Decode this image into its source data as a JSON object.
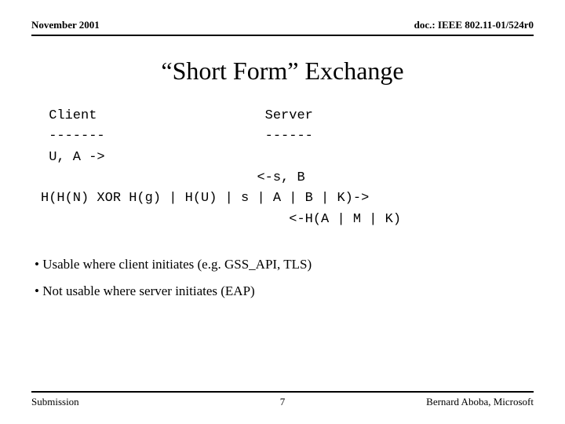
{
  "header": {
    "date": "November 2001",
    "docref": "doc.: IEEE 802.11-01/524r0"
  },
  "title": "“Short Form” Exchange",
  "exchange": {
    "l1": " Client                     Server",
    "l2": " -------                    ------",
    "l3": " U, A ->",
    "l4": "                           <-s, B",
    "l5": "H(H(N) XOR H(g) | H(U) | s | A | B | K)->",
    "l6": "                               <-H(A | M | K)"
  },
  "bullets": {
    "b1": "• Usable where client initiates (e.g. GSS_API, TLS)",
    "b2": "• Not usable where server initiates (EAP)"
  },
  "footer": {
    "left": "Submission",
    "center": "7",
    "right": "Bernard Aboba, Microsoft"
  }
}
